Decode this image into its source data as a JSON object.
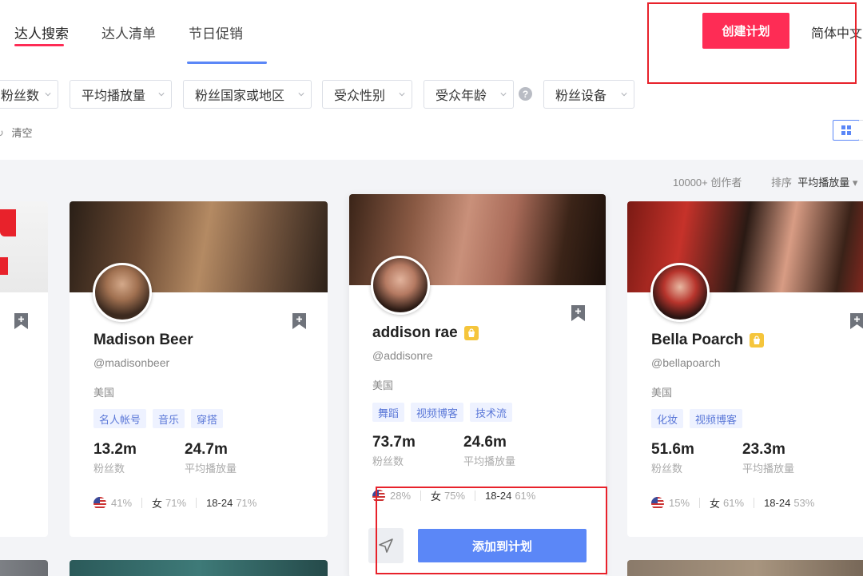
{
  "nav": {
    "tabs": [
      {
        "label": "达人搜索",
        "active": true
      },
      {
        "label": "达人清单",
        "active": false
      },
      {
        "label": "节日促销",
        "active": false
      }
    ],
    "create_button": "创建计划",
    "language": "简体中文"
  },
  "filters": {
    "items": [
      "粉丝数",
      "平均播放量",
      "粉丝国家或地区",
      "受众性别",
      "受众年龄",
      "粉丝设备"
    ],
    "help_icon": "?",
    "clear_label": "清空"
  },
  "results": {
    "count": "10000+ 创作者",
    "sort_label": "排序",
    "sort_value": "平均播放量"
  },
  "cards": [
    {
      "name": "Madison Beer",
      "handle": "@madisonbeer",
      "country": "美国",
      "verified": false,
      "tags": [
        "名人帐号",
        "音乐",
        "穿搭"
      ],
      "followers": "13.2m",
      "followers_label": "粉丝数",
      "avg_views": "24.7m",
      "avg_views_label": "平均播放量",
      "country_pct": "41%",
      "gender_label": "女",
      "gender_pct": "71%",
      "age_label": "18-24",
      "age_pct": "71%"
    },
    {
      "name": "addison rae",
      "handle": "@addisonre",
      "country": "美国",
      "verified": true,
      "tags": [
        "舞蹈",
        "视频博客",
        "技术流"
      ],
      "followers": "73.7m",
      "followers_label": "粉丝数",
      "avg_views": "24.6m",
      "avg_views_label": "平均播放量",
      "country_pct": "28%",
      "gender_label": "女",
      "gender_pct": "75%",
      "age_label": "18-24",
      "age_pct": "61%",
      "add_button": "添加到计划"
    },
    {
      "name": "Bella Poarch",
      "handle": "@bellapoarch",
      "country": "美国",
      "verified": true,
      "tags": [
        "化妆",
        "视频博客"
      ],
      "followers": "51.6m",
      "followers_label": "粉丝数",
      "avg_views": "23.3m",
      "avg_views_label": "平均播放量",
      "country_pct": "15%",
      "gender_label": "女",
      "gender_pct": "61%",
      "age_label": "18-24",
      "age_pct": "53%"
    }
  ],
  "colors": {
    "brand": "#fe2c55",
    "accent": "#5b87f7",
    "annotation": "#e8222b"
  }
}
